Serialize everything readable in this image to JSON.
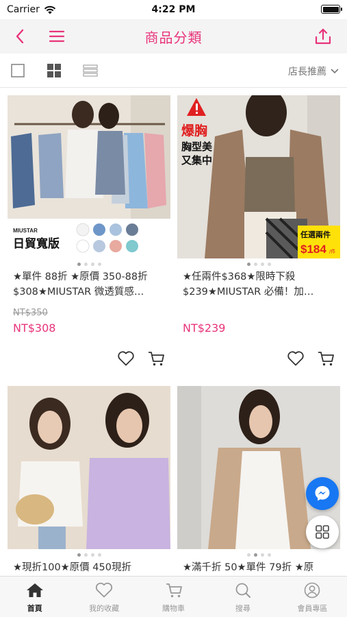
{
  "status": {
    "carrier": "Carrier",
    "time": "4:22 PM"
  },
  "nav": {
    "title": "商品分類"
  },
  "filter": {
    "sort_label": "店長推薦"
  },
  "products": [
    {
      "name": "★單件 88折 ★原價 350-88折 $308★MIUSTAR 微透質感…",
      "original_price": "NT$350",
      "price": "NT$308",
      "image_caption_brand": "MIUSTAR",
      "image_caption": "日貿寬版"
    },
    {
      "name": "★任兩件$368★限時下殺 $239★MIUSTAR 必備！加…",
      "original_price": "",
      "price": "NT$239",
      "image_badge_line1": "爆胸",
      "image_badge_line2": "胸型美",
      "image_badge_line3": "又集中",
      "image_tag_line1": "任選兩件",
      "image_tag_line2": "$184",
      "image_tag_suffix": "/件"
    },
    {
      "name": "★現折100★原價 450現折"
    },
    {
      "name": "★滿千折 50★單件 79折 ★原"
    }
  ],
  "tabs": [
    {
      "label": "首頁"
    },
    {
      "label": "我的收藏"
    },
    {
      "label": "購物車"
    },
    {
      "label": "搜尋"
    },
    {
      "label": "會員專區"
    }
  ],
  "colors": {
    "accent": "#e8337a",
    "messenger": "#1877f2"
  }
}
